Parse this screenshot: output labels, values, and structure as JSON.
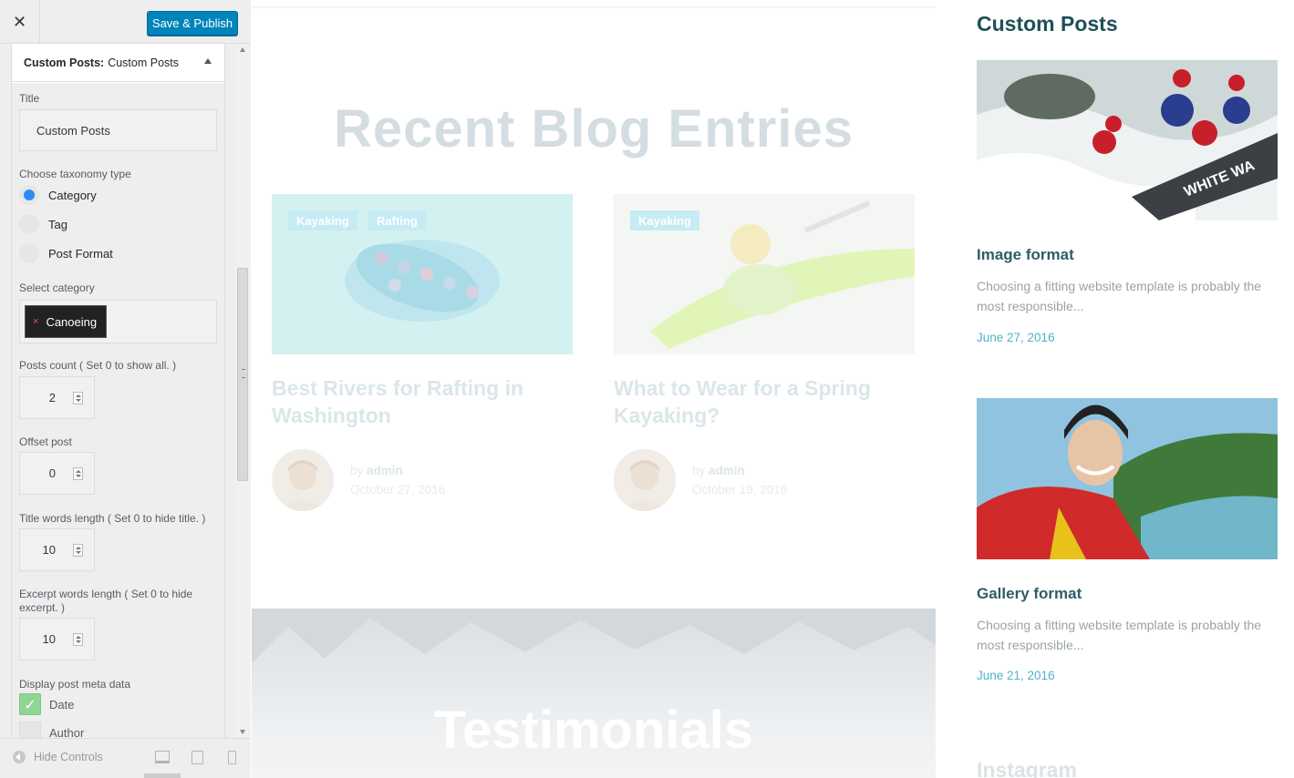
{
  "header": {
    "close_glyph": "✕",
    "publish_label": "Save & Publish"
  },
  "section": {
    "prefix": "Custom Posts:",
    "name": "Custom Posts"
  },
  "form": {
    "title_label": "Title",
    "title_value": "Custom Posts",
    "taxonomy_label": "Choose taxonomy type",
    "taxonomy_options": [
      "Category",
      "Tag",
      "Post Format"
    ],
    "taxonomy_selected": "Category",
    "category_label": "Select category",
    "category_chip": "Canoeing",
    "chip_remove": "×",
    "posts_count_label": "Posts count ( Set 0 to show all. )",
    "posts_count": "2",
    "offset_label": "Offset post",
    "offset": "0",
    "title_words_label": "Title words length ( Set 0 to hide title. )",
    "title_words": "10",
    "excerpt_label": "Excerpt words length ( Set 0 to hide excerpt. )",
    "excerpt_words": "10",
    "meta_label": "Display post meta data",
    "meta_date": "Date",
    "meta_author": "Author"
  },
  "footer": {
    "hide_controls": "Hide Controls",
    "device_icons": [
      "desktop-icon",
      "tablet-icon",
      "mobile-icon"
    ]
  },
  "preview": {
    "blog_heading": "Recent Blog Entries",
    "posts": [
      {
        "tags": [
          "Kayaking",
          "Rafting"
        ],
        "title": "Best Rivers for Rafting in Washington",
        "by": "by",
        "author": "admin",
        "date": "October 27, 2016"
      },
      {
        "tags": [
          "Kayaking"
        ],
        "title": "What to Wear for a Spring Kayaking?",
        "by": "by",
        "author": "admin",
        "date": "October 19, 2016"
      }
    ],
    "testimonials_heading": "Testimonials",
    "widget_title": "Custom Posts",
    "widget_posts": [
      {
        "title": "Image format",
        "excerpt": "Choosing a fitting website template is probably the most responsible...",
        "date": "June 27, 2016"
      },
      {
        "title": "Gallery format",
        "excerpt": "Choosing a fitting website template is probably the most responsible...",
        "date": "June 21, 2016"
      }
    ],
    "instagram_heading": "Instagram"
  },
  "colors": {
    "accent": "#0085ba",
    "radio_on": "#2d8cf0",
    "checkbox_on": "#8fd694",
    "widget_title": "#1f4f58",
    "date_link": "#4fb3c9"
  }
}
